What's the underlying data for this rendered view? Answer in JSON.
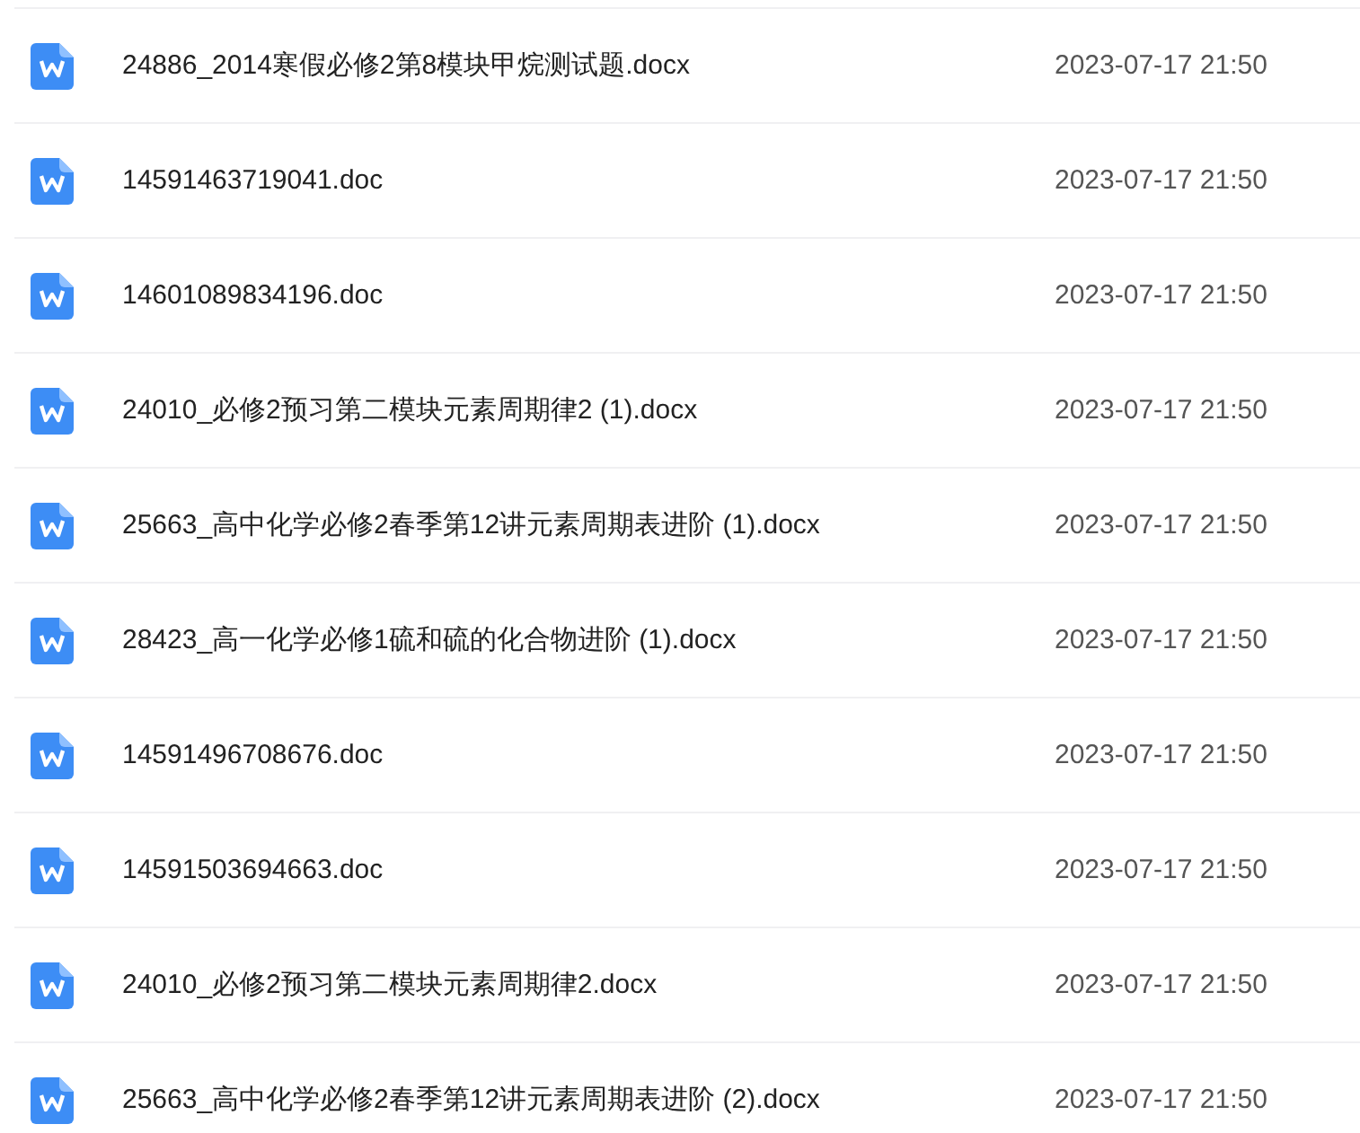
{
  "files": [
    {
      "name": "24886_2014寒假必修2第8模块甲烷测试题.docx",
      "modified": "2023-07-17 21:50"
    },
    {
      "name": "14591463719041.doc",
      "modified": "2023-07-17 21:50"
    },
    {
      "name": "14601089834196.doc",
      "modified": "2023-07-17 21:50"
    },
    {
      "name": "24010_必修2预习第二模块元素周期律2 (1).docx",
      "modified": "2023-07-17 21:50"
    },
    {
      "name": "25663_高中化学必修2春季第12讲元素周期表进阶 (1).docx",
      "modified": "2023-07-17 21:50"
    },
    {
      "name": "28423_高一化学必修1硫和硫的化合物进阶 (1).docx",
      "modified": "2023-07-17 21:50"
    },
    {
      "name": "14591496708676.doc",
      "modified": "2023-07-17 21:50"
    },
    {
      "name": "14591503694663.doc",
      "modified": "2023-07-17 21:50"
    },
    {
      "name": "24010_必修2预习第二模块元素周期律2.docx",
      "modified": "2023-07-17 21:50"
    },
    {
      "name": "25663_高中化学必修2春季第12讲元素周期表进阶 (2).docx",
      "modified": "2023-07-17 21:50"
    }
  ]
}
